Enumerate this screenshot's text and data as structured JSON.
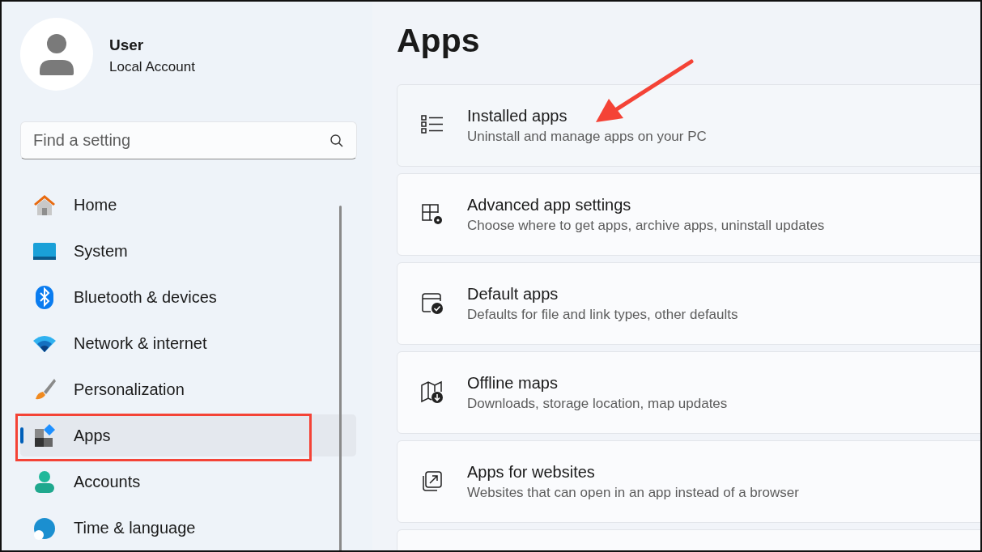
{
  "account": {
    "name": "User",
    "type": "Local Account"
  },
  "search": {
    "placeholder": "Find a setting"
  },
  "nav": [
    {
      "label": "Home",
      "selected": false
    },
    {
      "label": "System",
      "selected": false
    },
    {
      "label": "Bluetooth & devices",
      "selected": false
    },
    {
      "label": "Network & internet",
      "selected": false
    },
    {
      "label": "Personalization",
      "selected": false
    },
    {
      "label": "Apps",
      "selected": true
    },
    {
      "label": "Accounts",
      "selected": false
    },
    {
      "label": "Time & language",
      "selected": false
    }
  ],
  "page_title": "Apps",
  "cards": [
    {
      "kind": "setting",
      "title": "Installed apps",
      "subtitle": "Uninstall and manage apps on your PC"
    },
    {
      "kind": "setting",
      "title": "Advanced app settings",
      "subtitle": "Choose where to get apps, archive apps, uninstall updates"
    },
    {
      "kind": "setting",
      "title": "Default apps",
      "subtitle": "Defaults for file and link types, other defaults"
    },
    {
      "kind": "setting",
      "title": "Offline maps",
      "subtitle": "Downloads, storage location, map updates"
    },
    {
      "kind": "setting",
      "title": "Apps for websites",
      "subtitle": "Websites that can open in an app instead of a browser"
    },
    {
      "kind": "blank"
    }
  ],
  "annotations": [
    {
      "kind": "arrow"
    },
    {
      "kind": "box"
    }
  ]
}
